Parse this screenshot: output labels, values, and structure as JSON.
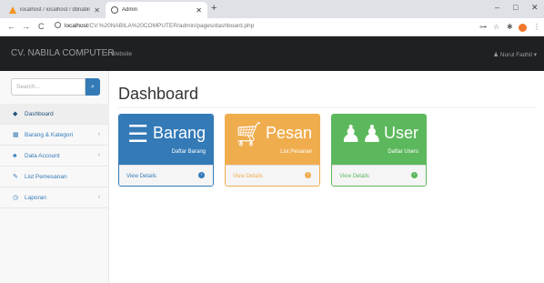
{
  "browser": {
    "tabs": [
      {
        "label": "localhost / localhost / dbnabila | ",
        "close": "✕"
      },
      {
        "label": "Admin",
        "close": "✕"
      }
    ],
    "new_tab": "+",
    "window": {
      "minimize": "–",
      "maximize": "□",
      "close": "✕"
    },
    "nav": {
      "back": "←",
      "forward": "→",
      "reload": "C"
    },
    "url": {
      "host": "localhost",
      "path": "/CV.%20NABILA%20COMPUTER/admin/pages/dashboard.php"
    }
  },
  "navbar": {
    "brand": "CV. NABILA COMPUTER",
    "website_link": "Website",
    "user_menu": "Nurul Fadhil"
  },
  "sidebar": {
    "search_placeholder": "Search...",
    "items": [
      {
        "label": "Dashboard",
        "icon": "dashboard-icon",
        "glyph": "◆",
        "has_arrow": false,
        "active": true
      },
      {
        "label": "Barang & Kategori",
        "icon": "table-icon",
        "glyph": "▦",
        "has_arrow": true
      },
      {
        "label": "Data Account",
        "icon": "sitemap-icon",
        "glyph": "♣",
        "has_arrow": true
      },
      {
        "label": "List Pemesanan",
        "icon": "edit-icon",
        "glyph": "✎",
        "has_arrow": false
      },
      {
        "label": "Laporan",
        "icon": "clock-icon",
        "glyph": "◷",
        "has_arrow": true
      }
    ]
  },
  "main": {
    "title": "Dashboard",
    "panels": [
      {
        "title": "Barang",
        "subtitle": "Daftar Barang",
        "footer": "View Details",
        "icon": "list-alt-icon",
        "color": "#337ab7"
      },
      {
        "title": "Pesan",
        "subtitle": "List Pesanan",
        "footer": "View Details",
        "icon": "shopping-cart-icon",
        "color": "#f0ad4e"
      },
      {
        "title": "User",
        "subtitle": "Daftar Users",
        "footer": "View Details",
        "icon": "users-icon",
        "color": "#5cb85c"
      }
    ]
  }
}
